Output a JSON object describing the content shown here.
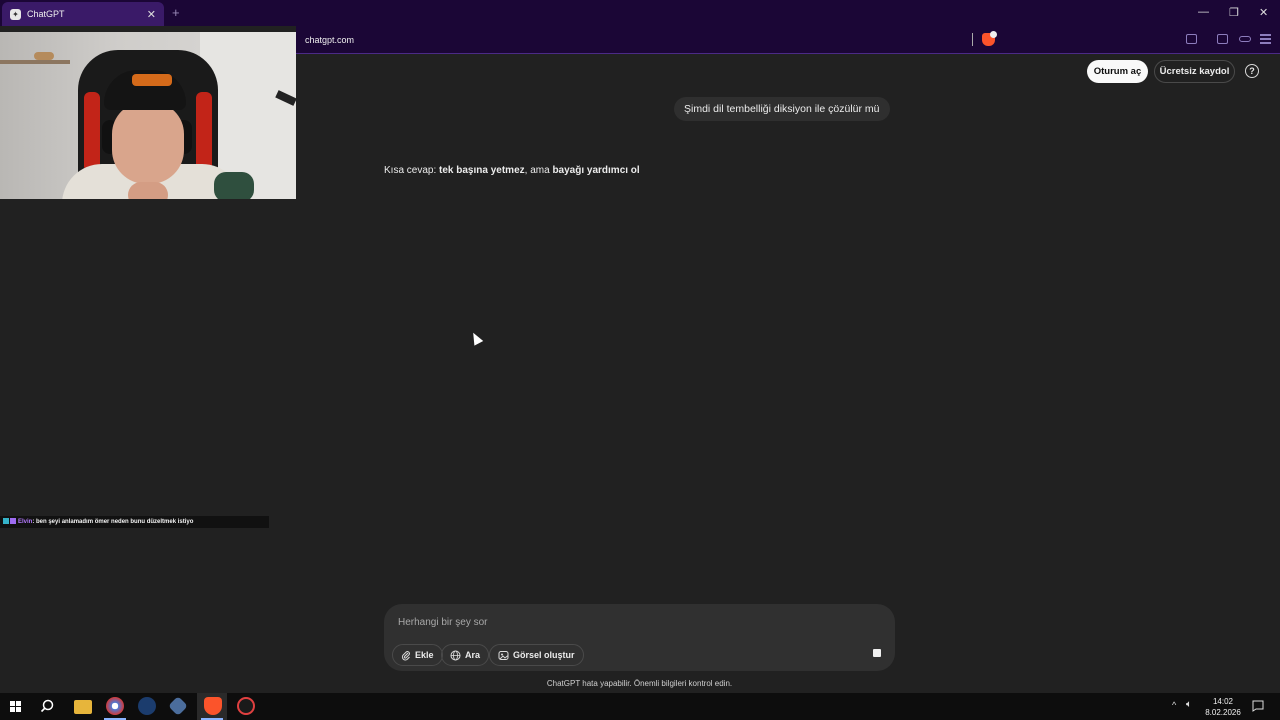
{
  "browser": {
    "tab_title": "ChatGPT",
    "tab_favicon": "chatgpt-icon",
    "url": "chatgpt.com",
    "accent_color": "#1b0636"
  },
  "header": {
    "login_label": "Oturum aç",
    "signup_label": "Ücretsiz kaydol",
    "help_glyph": "?"
  },
  "conversation": {
    "user_message": "Şimdi dil tembelliği diksiyon ile çözülür mü",
    "reply_prefix": "Kısa cevap: ",
    "reply_bold_1": "tek başına yetmez",
    "reply_mid": ", ama ",
    "reply_bold_2": "bayağı yardımcı ol"
  },
  "stream_chat": {
    "username": "Elvin",
    "message": ": ben şeyi anlamadım ömer neden bunu düzeltmek istiyo"
  },
  "composer": {
    "placeholder": "Herhangi bir şey sor",
    "attach_label": "Ekle",
    "search_label": "Ara",
    "image_label": "Görsel oluştur"
  },
  "footer": {
    "disclaimer": "ChatGPT hata yapabilir. Önemli bilgileri kontrol edin."
  },
  "taskbar": {
    "time": "14:02",
    "date": "8.02.2026"
  }
}
